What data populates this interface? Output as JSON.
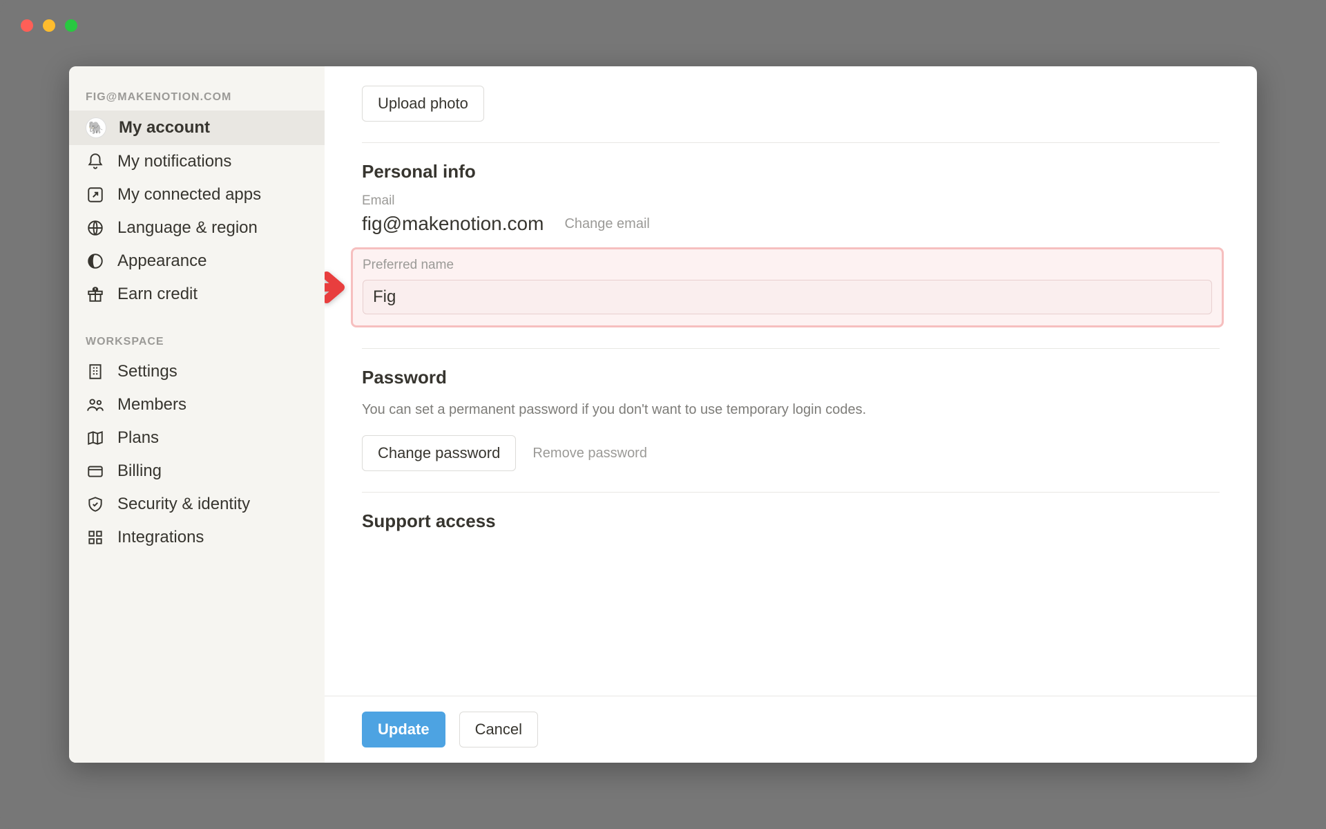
{
  "sidebar": {
    "account_header": "FIG@MAKENOTION.COM",
    "workspace_header": "WORKSPACE",
    "items_account": [
      {
        "label": "My account"
      },
      {
        "label": "My notifications"
      },
      {
        "label": "My connected apps"
      },
      {
        "label": "Language & region"
      },
      {
        "label": "Appearance"
      },
      {
        "label": "Earn credit"
      }
    ],
    "items_workspace": [
      {
        "label": "Settings"
      },
      {
        "label": "Members"
      },
      {
        "label": "Plans"
      },
      {
        "label": "Billing"
      },
      {
        "label": "Security & identity"
      },
      {
        "label": "Integrations"
      }
    ]
  },
  "main": {
    "upload_photo_label": "Upload photo",
    "personal_info_title": "Personal info",
    "email_label": "Email",
    "email_value": "fig@makenotion.com",
    "change_email_label": "Change email",
    "preferred_name_label": "Preferred name",
    "preferred_name_value": "Fig",
    "password_title": "Password",
    "password_desc": "You can set a permanent password if you don't want to use temporary login codes.",
    "change_password_label": "Change password",
    "remove_password_label": "Remove password",
    "support_title": "Support access",
    "update_label": "Update",
    "cancel_label": "Cancel"
  }
}
